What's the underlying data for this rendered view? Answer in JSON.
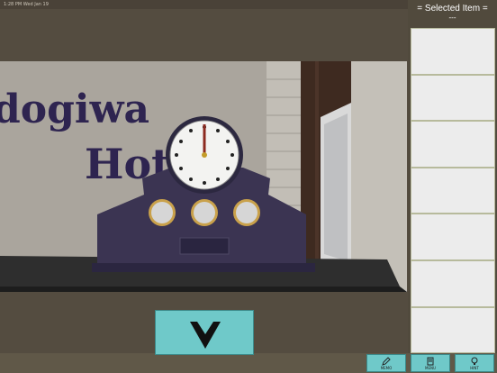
{
  "status": {
    "left": "1:28 PM   Wed Jan 19"
  },
  "scene": {
    "sign_line1": "dogiwa",
    "sign_line2": "Hot"
  },
  "side_panel": {
    "title": "= Selected Item =",
    "value": "---",
    "slot_count": 7
  },
  "toolbar": [
    {
      "label": "MEMO",
      "icon": "pencil-icon"
    },
    {
      "label": "MENU",
      "icon": "menu-icon"
    },
    {
      "label": "HINT",
      "icon": "bulb-icon"
    }
  ],
  "navigation": {
    "icon": "down-arrow-icon"
  },
  "clock": {
    "hour_hand": 12,
    "minute_hand": 0
  }
}
